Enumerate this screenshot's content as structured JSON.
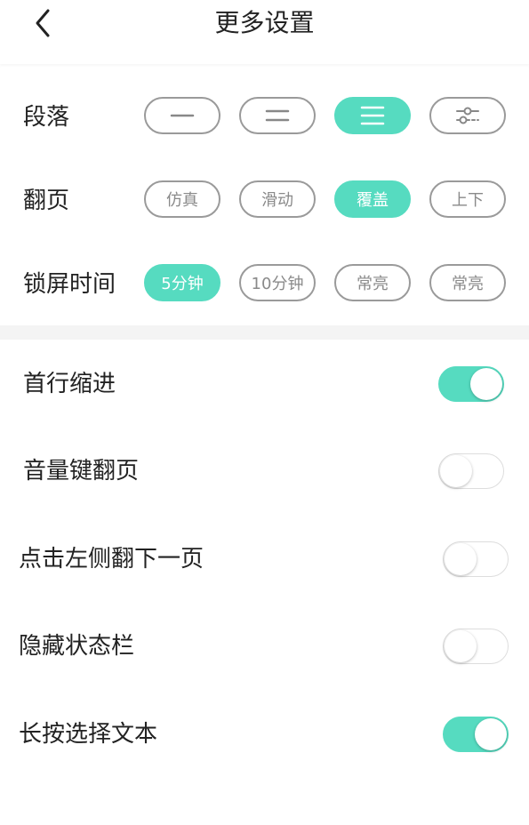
{
  "header": {
    "title": "更多设置",
    "back_icon": "chevron-left-icon"
  },
  "paragraph": {
    "label": "段落",
    "options": [
      {
        "icon": "single-line-icon",
        "selected": false
      },
      {
        "icon": "double-line-icon",
        "selected": false
      },
      {
        "icon": "triple-line-icon",
        "selected": true
      },
      {
        "icon": "custom-slider-icon",
        "selected": false
      }
    ]
  },
  "page_turn": {
    "label": "翻页",
    "options": [
      {
        "label": "仿真",
        "selected": false
      },
      {
        "label": "滑动",
        "selected": false
      },
      {
        "label": "覆盖",
        "selected": true
      },
      {
        "label": "上下",
        "selected": false
      }
    ]
  },
  "lock_time": {
    "label": "锁屏时间",
    "options": [
      {
        "label": "5分钟",
        "selected": true
      },
      {
        "label": "10分钟",
        "selected": false
      },
      {
        "label": "常亮",
        "selected": false
      },
      {
        "label": "常亮",
        "selected": false
      }
    ]
  },
  "toggles": [
    {
      "label": "首行缩进",
      "on": true
    },
    {
      "label": "音量键翻页",
      "on": false
    },
    {
      "label": "点击左侧翻下一页",
      "on": false
    },
    {
      "label": "隐藏状态栏",
      "on": false
    },
    {
      "label": "长按选择文本",
      "on": true
    }
  ],
  "colors": {
    "accent": "#56dbc0",
    "border": "#9a9a9a",
    "text": "#222222",
    "muted_text": "#8a8a8a",
    "band": "#f4f4f4"
  }
}
